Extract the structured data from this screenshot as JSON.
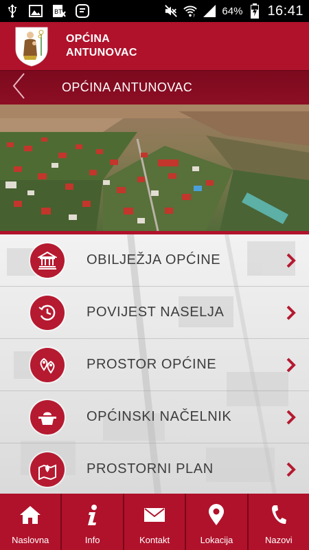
{
  "status_bar": {
    "battery_percent": "64%",
    "time": "16:41",
    "icons": [
      "usb-icon",
      "image-icon",
      "nfc-icon",
      "chat-icon",
      "mute-icon",
      "wifi-icon",
      "signal-icon",
      "battery-icon"
    ]
  },
  "header": {
    "title_line1": "OPĆINA",
    "title_line2": "ANTUNOVAC",
    "crest_icon": "municipality-crest"
  },
  "subheader": {
    "title": "OPĆINA ANTUNOVAC",
    "back_icon": "chevron-left-icon"
  },
  "menu": {
    "items": [
      {
        "label": "OBILJEŽJA OPĆINE",
        "icon": "building-columns-icon"
      },
      {
        "label": "POVIJEST NASELJA",
        "icon": "history-clock-icon"
      },
      {
        "label": "PROSTOR OPĆINE",
        "icon": "map-pins-icon"
      },
      {
        "label": "OPĆINSKI NAČELNIK",
        "icon": "podium-icon"
      },
      {
        "label": "PROSTORNI PLAN",
        "icon": "map-location-icon"
      }
    ],
    "chevron_icon": "chevron-right-icon"
  },
  "bottom_nav": {
    "items": [
      {
        "label": "Naslovna",
        "icon": "home-icon"
      },
      {
        "label": "Info",
        "icon": "info-icon"
      },
      {
        "label": "Kontakt",
        "icon": "envelope-icon"
      },
      {
        "label": "Lokacija",
        "icon": "location-pin-icon"
      },
      {
        "label": "Nazovi",
        "icon": "phone-icon"
      }
    ]
  },
  "colors": {
    "brand_red": "#b0122b",
    "dark_red": "#8d0e24",
    "menu_text": "#3d3d3d"
  }
}
